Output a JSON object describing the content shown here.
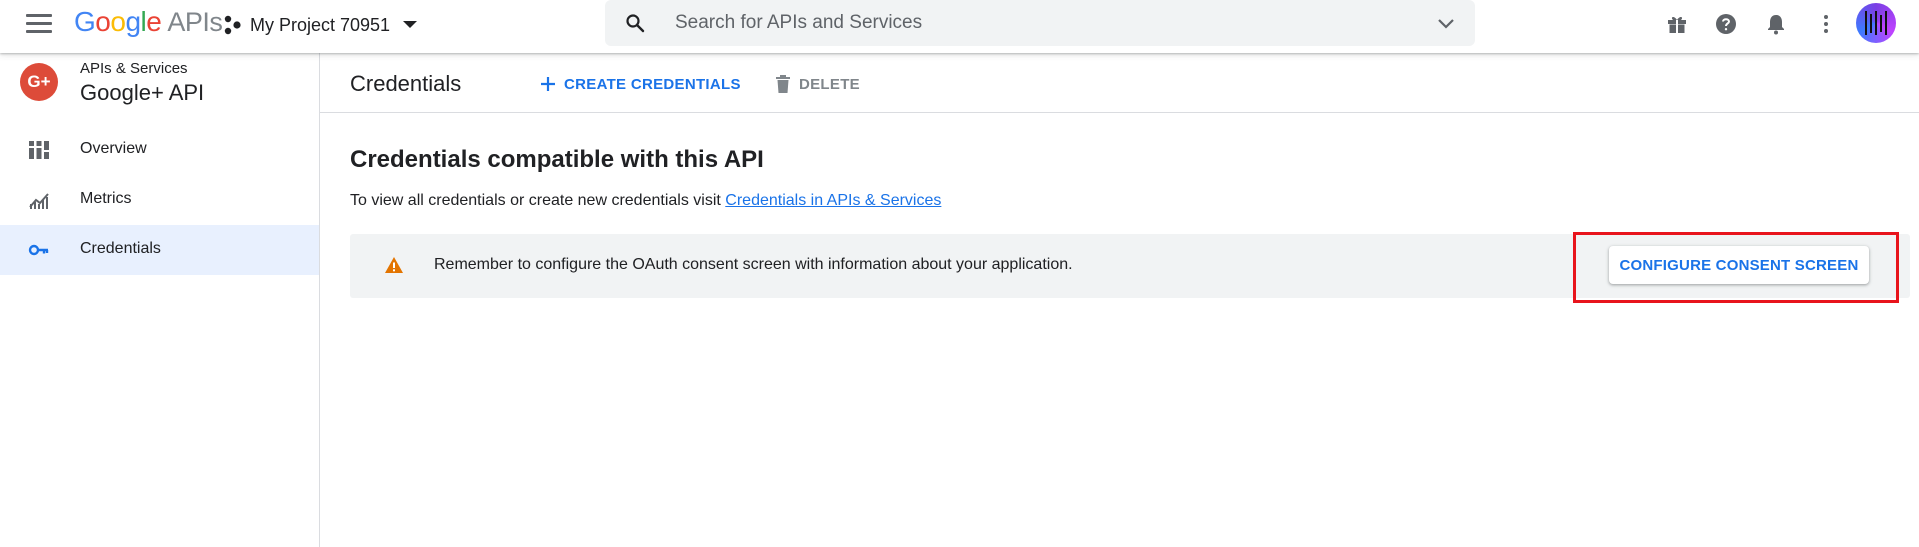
{
  "topbar": {
    "brand_letters": [
      "G",
      "o",
      "o",
      "g",
      "l",
      "e"
    ],
    "brand_colors": [
      "#4285f4",
      "#ea4335",
      "#fbbc05",
      "#4285f4",
      "#34a853",
      "#ea4335"
    ],
    "brand_suffix": "APIs",
    "project_name": "My Project 70951",
    "search_placeholder": "Search for APIs and Services",
    "icons": [
      "menu-icon",
      "project-dots-icon",
      "search-icon",
      "gift-icon",
      "help-icon",
      "notifications-icon",
      "more-vert-icon"
    ]
  },
  "sidebar": {
    "logo_text": "G+",
    "section": "APIs & Services",
    "api_name": "Google+ API",
    "items": [
      {
        "label": "Overview",
        "icon": "dashboard-icon",
        "active": false
      },
      {
        "label": "Metrics",
        "icon": "metrics-icon",
        "active": false
      },
      {
        "label": "Credentials",
        "icon": "key-icon",
        "active": true
      }
    ]
  },
  "main": {
    "title": "Credentials",
    "create_label": "CREATE CREDENTIALS",
    "delete_label": "DELETE",
    "section_title": "Credentials compatible with this API",
    "section_desc": "To view all credentials or create new credentials visit ",
    "section_link": "Credentials in APIs & Services",
    "alert_text": "Remember to configure the OAuth consent screen with information about your application.",
    "consent_button": "CONFIGURE CONSENT SCREEN"
  },
  "colors": {
    "accent": "#1a73e8",
    "warning": "#e37400",
    "highlight": "#e8141c",
    "active_nav": "#e8f0fe"
  }
}
